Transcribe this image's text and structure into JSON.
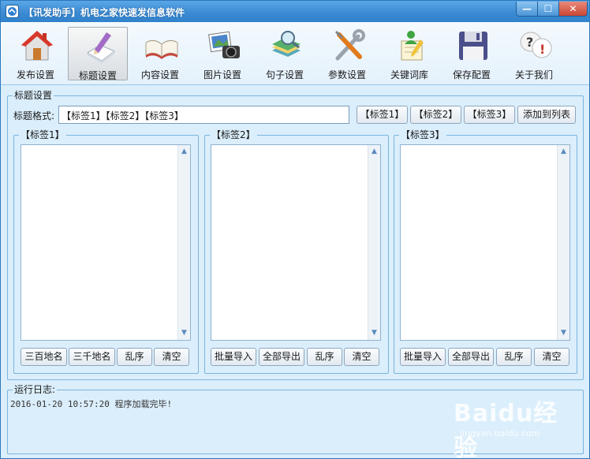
{
  "window": {
    "title": "【讯发助手】机电之家快速发信息软件",
    "controls": {
      "minimize": "—",
      "maximize": "☐",
      "close": "✕"
    }
  },
  "toolbar": {
    "items": [
      {
        "label": "发布设置",
        "icon": "house-icon"
      },
      {
        "label": "标题设置",
        "icon": "pencil-paper-icon",
        "active": true
      },
      {
        "label": "内容设置",
        "icon": "open-book-icon"
      },
      {
        "label": "图片设置",
        "icon": "photo-camera-icon"
      },
      {
        "label": "句子设置",
        "icon": "books-magnifier-icon"
      },
      {
        "label": "参数设置",
        "icon": "tools-icon"
      },
      {
        "label": "关键词库",
        "icon": "person-notepad-icon"
      },
      {
        "label": "保存配置",
        "icon": "floppy-disk-icon"
      },
      {
        "label": "关于我们",
        "icon": "question-mark-icon"
      }
    ]
  },
  "title_settings": {
    "legend": "标题设置",
    "format_label": "标题格式:",
    "format_value": "【标签1】【标签2】【标签3】",
    "tag_buttons": [
      "【标签1】",
      "【标签2】",
      "【标签3】"
    ],
    "add_to_list": "添加到列表"
  },
  "panels": [
    {
      "legend": "【标签1】",
      "buttons": [
        "三百地名",
        "三千地名",
        "乱序",
        "清空"
      ]
    },
    {
      "legend": "【标签2】",
      "buttons": [
        "批量导入",
        "全部导出",
        "乱序",
        "清空"
      ]
    },
    {
      "legend": "【标签3】",
      "buttons": [
        "批量导入",
        "全部导出",
        "乱序",
        "清空"
      ]
    }
  ],
  "log": {
    "legend": "运行日志:",
    "entry": "2016-01-20 10:57:20  程序加载完毕!"
  },
  "watermark": {
    "main": "Baidu经验",
    "sub": "jingyan.baidu.com"
  },
  "colors": {
    "titlebar": "#3a8ad3",
    "window_bg": "#dbeefb",
    "groupbox_border": "#7ab5de"
  }
}
